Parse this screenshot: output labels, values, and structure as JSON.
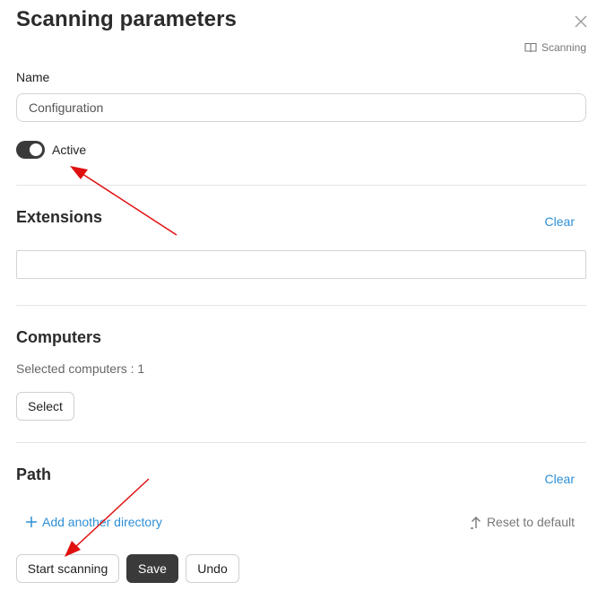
{
  "header": {
    "title": "Scanning parameters",
    "doc_link_label": "Scanning"
  },
  "name_field": {
    "label": "Name",
    "value": "Configuration"
  },
  "active_toggle": {
    "label": "Active",
    "on": true
  },
  "extensions": {
    "title": "Extensions",
    "clear_label": "Clear",
    "value": ""
  },
  "computers": {
    "title": "Computers",
    "selected_text": "Selected computers : 1",
    "select_label": "Select"
  },
  "path": {
    "title": "Path",
    "clear_label": "Clear",
    "add_directory_label": "Add another directory",
    "reset_label": "Reset to default"
  },
  "footer": {
    "start_label": "Start scanning",
    "save_label": "Save",
    "undo_label": "Undo"
  },
  "colors": {
    "accent_link": "#2e8fd6",
    "dark_button": "#3a3a3a",
    "annotation_arrow": "#e01010"
  }
}
